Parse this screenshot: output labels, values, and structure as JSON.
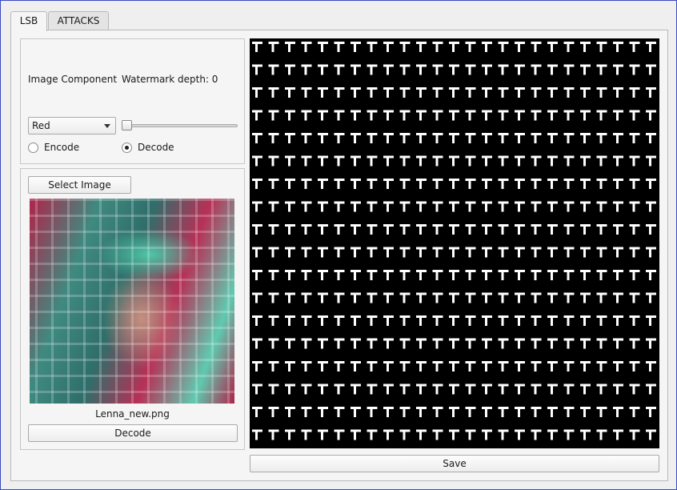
{
  "tabs": [
    {
      "label": "LSB",
      "active": true
    },
    {
      "label": "ATTACKS",
      "active": false
    }
  ],
  "settings": {
    "component_label": "Image Component",
    "depth_label": "Watermark depth: 0",
    "watermark_depth": 0,
    "component_selected": "Red",
    "encode_label": "Encode",
    "decode_label": "Decode",
    "mode_selected": "Decode"
  },
  "image_panel": {
    "select_button": "Select Image",
    "filename": "Lenna_new.png",
    "decode_button": "Decode"
  },
  "output": {
    "save_button": "Save"
  },
  "colors": {
    "window_border": "#3a4ac0",
    "canvas_bg": "#000000",
    "canvas_pattern": "#ffffff"
  }
}
